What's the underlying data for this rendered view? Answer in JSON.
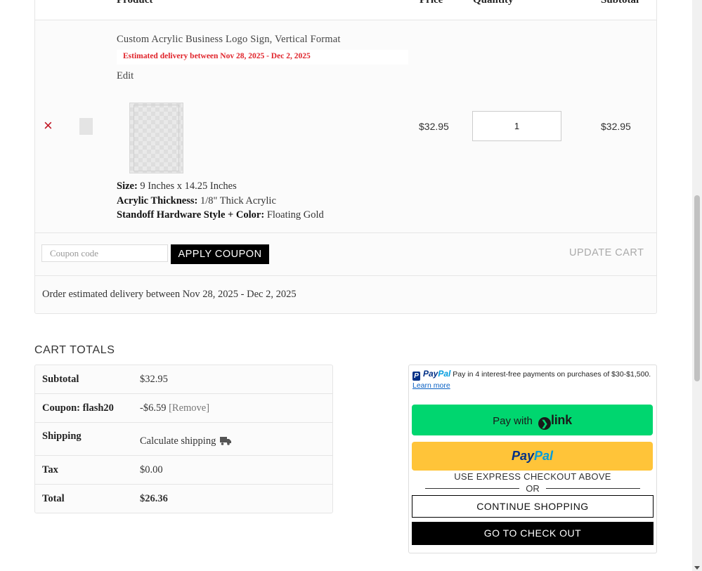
{
  "cart_table": {
    "headers": [
      "Product",
      "Price",
      "Quantity",
      "Subtotal"
    ],
    "item": {
      "name": "Custom Acrylic Business Logo Sign, Vertical Format",
      "delivery_note": "Estimated delivery between Nov 28, 2025 - Dec 2, 2025",
      "edit_label": "Edit",
      "attributes": [
        {
          "label": "Size:",
          "value": "9 Inches x 14.25 Inches"
        },
        {
          "label": "Acrylic Thickness:",
          "value": "1/8\" Thick Acrylic"
        },
        {
          "label": "Standoff Hardware Style + Color:",
          "value": "Floating Gold"
        }
      ],
      "price": "$32.95",
      "quantity": "1",
      "subtotal": "$32.95",
      "remove_symbol": "×"
    },
    "coupon": {
      "placeholder": "Coupon code",
      "apply_label": "APPLY COUPON",
      "update_label": "UPDATE CART"
    },
    "order_delivery": "Order estimated delivery between Nov 28, 2025 - Dec 2, 2025"
  },
  "totals": {
    "title": "CART TOTALS",
    "subtotal_label": "Subtotal",
    "subtotal_value": "$32.95",
    "coupon_label": "Coupon: flash20",
    "coupon_value": "-$6.59",
    "coupon_remove": "[Remove]",
    "shipping_label": "Shipping",
    "shipping_value": "Calculate shipping",
    "tax_label": "Tax",
    "tax_value": "$0.00",
    "total_label": "Total",
    "total_value": "$26.36"
  },
  "express": {
    "paypal_brand_1": "Pay",
    "paypal_brand_2": "Pal",
    "paypal_message": "Pay in 4 interest-free payments on purchases of $30-$1,500.",
    "learn_more": "Learn more",
    "link_button_prefix": "Pay with",
    "link_word": "link",
    "express_note": "USE EXPRESS CHECKOUT ABOVE",
    "or_label": "OR",
    "continue_label": "CONTINUE SHOPPING",
    "checkout_label": "GO TO CHECK OUT"
  },
  "colors": {
    "accent_red": "#e0242b",
    "link_green": "#00d66f",
    "paypal_yellow": "#ffc439",
    "paypal_navy": "#003087",
    "paypal_blue": "#009cde"
  }
}
